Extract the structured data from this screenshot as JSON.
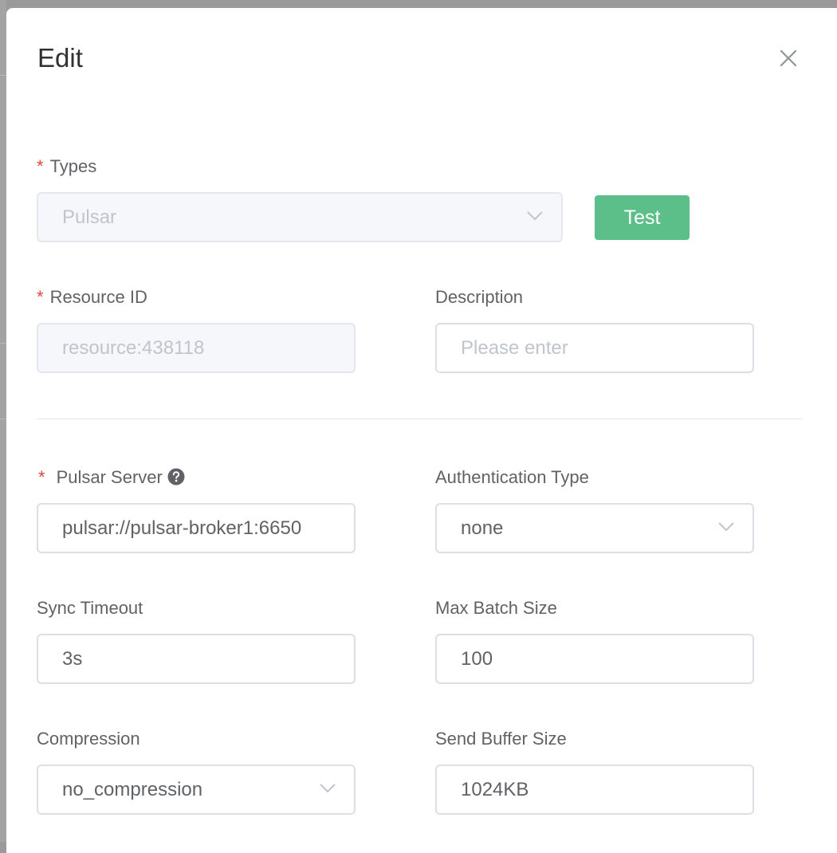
{
  "dialog": {
    "title": "Edit"
  },
  "fields": {
    "types": {
      "label": "Types",
      "value": "Pulsar",
      "required": "*"
    },
    "test_button": "Test",
    "resource_id": {
      "label": "Resource ID",
      "value": "resource:438118",
      "required": "*"
    },
    "description": {
      "label": "Description",
      "placeholder": "Please enter"
    },
    "pulsar_server": {
      "label": "Pulsar Server",
      "value": "pulsar://pulsar-broker1:6650",
      "required": "*"
    },
    "auth_type": {
      "label": "Authentication Type",
      "value": "none"
    },
    "sync_timeout": {
      "label": "Sync Timeout",
      "value": "3s"
    },
    "max_batch_size": {
      "label": "Max Batch Size",
      "value": "100"
    },
    "compression": {
      "label": "Compression",
      "value": "no_compression"
    },
    "send_buffer_size": {
      "label": "Send Buffer Size",
      "value": "1024KB"
    }
  },
  "icons": {
    "close": "close-icon",
    "help": "question-circle-icon",
    "dropdown": "chevron-down-icon"
  },
  "colors": {
    "primary_button": "#5cbf8a",
    "required_asterisk": "#e0463e",
    "backdrop": "#9a9a9a"
  }
}
